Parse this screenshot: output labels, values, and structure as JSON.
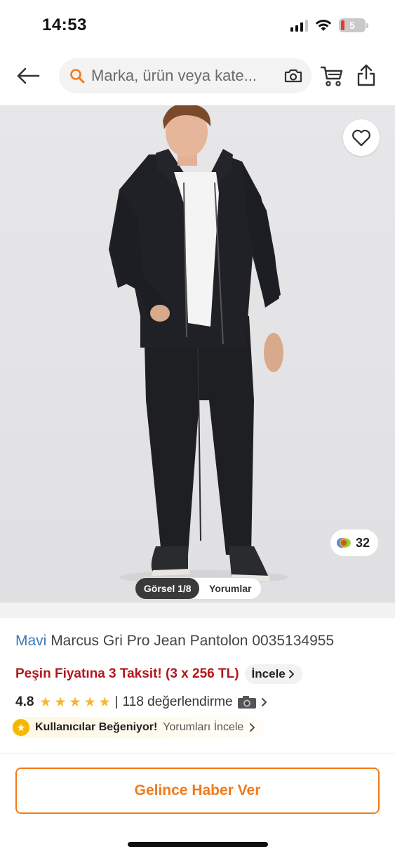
{
  "status_bar": {
    "time": "14:53",
    "battery_level": "5",
    "signal_bars_active": 3,
    "icons": [
      "signal-icon",
      "wifi-icon",
      "battery-icon"
    ]
  },
  "header": {
    "back_icon": "arrow-left-icon",
    "search": {
      "placeholder": "Marka, ürün veya kate...",
      "left_icon": "search-icon",
      "right_icon": "camera-icon"
    },
    "cart_icon": "cart-icon",
    "share_icon": "share-icon"
  },
  "product_image": {
    "favorite_icon": "heart-icon",
    "colors_count": "32",
    "tabs": [
      {
        "label": "Görsel 1/8",
        "active": true
      },
      {
        "label": "Yorumlar",
        "active": false
      }
    ]
  },
  "product": {
    "brand": "Mavi",
    "name": "Marcus Gri Pro Jean Pantolon 0035134955",
    "installment_text": "Peşin Fiyatına 3 Taksit! (3 x 256 TL)",
    "installment_link": "İncele",
    "rating": "4.8",
    "stars": 5,
    "separator": "|",
    "reviews": "118 değerlendirme",
    "liked_label": "Kullanıcılar Beğeniyor!",
    "liked_link": "Yorumları İncele"
  },
  "bottom": {
    "notify_label": "Gelince Haber Ver"
  },
  "colors": {
    "accent": "#f27a1a",
    "brand_link": "#3c79b8",
    "installment_red": "#b3161c",
    "star": "#f9b52c"
  }
}
